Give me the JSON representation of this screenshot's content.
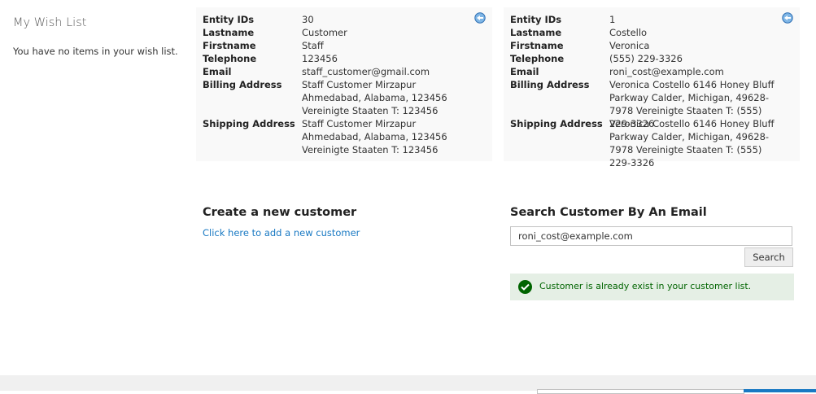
{
  "wishlist": {
    "title": "My Wish List",
    "empty_text": "You have no items in your wish list."
  },
  "customers": [
    {
      "labels": [
        "Entity IDs",
        "Lastname",
        "Firstname",
        "Telephone",
        "Email",
        "Billing Address",
        "Shipping Address"
      ],
      "entity_id": "30",
      "lastname": "Customer",
      "firstname": "Staff",
      "telephone": "123456",
      "email": "staff_customer@gmail.com",
      "billing_address": "Staff Customer Mirzapur Ahmedabad, Alabama, 123456 Vereinigte Staaten T: 123456",
      "shipping_address": "Staff Customer Mirzapur Ahmedabad, Alabama, 123456 Vereinigte Staaten T: 123456",
      "edit_icon": "edit-arrow-icon"
    },
    {
      "labels": [
        "Entity IDs",
        "Lastname",
        "Firstname",
        "Telephone",
        "Email",
        "Billing Address",
        "Shipping Address"
      ],
      "entity_id": "1",
      "lastname": "Costello",
      "firstname": "Veronica",
      "telephone": "(555) 229-3326",
      "email": "roni_cost@example.com",
      "billing_address": "Veronica Costello 6146 Honey Bluff Parkway Calder, Michigan, 49628-7978 Vereinigte Staaten T: (555) 229-3326",
      "shipping_address": "Veronica Costello 6146 Honey Bluff Parkway Calder, Michigan, 49628-7978 Vereinigte Staaten T: (555) 229-3326",
      "edit_icon": "edit-arrow-icon"
    }
  ],
  "create": {
    "title": "Create a new customer",
    "link": "Click here to add a new customer"
  },
  "search": {
    "title": "Search Customer By An Email",
    "value": "roni_cost@example.com",
    "button": "Search"
  },
  "message": {
    "text": "Customer is already exist in your customer list.",
    "icon": "success-check-icon"
  },
  "colors": {
    "link": "#1979c3",
    "success_bg": "#e5efe5",
    "success_text": "#006400",
    "card_bg": "#f9f9f9"
  }
}
